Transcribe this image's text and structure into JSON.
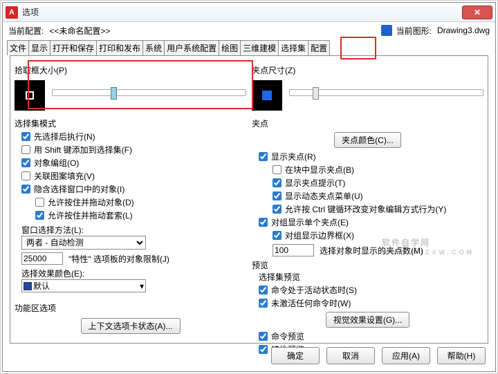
{
  "window": {
    "title": "选项"
  },
  "systembar": {
    "current_profile_label": "当前配置:",
    "current_profile_value": "<<未命名配置>>",
    "current_drawing_label": "当前图形:",
    "current_drawing_value": "Drawing3.dwg"
  },
  "tabs": {
    "t0": "文件",
    "t1": "显示",
    "t2": "打开和保存",
    "t3": "打印和发布",
    "t4": "系统",
    "t5": "用户系统配置",
    "t6": "绘图",
    "t7": "三维建模",
    "t8": "选择集",
    "t9": "配置"
  },
  "left": {
    "pickbox_label": "拾取框大小(P)",
    "selmode_label": "选择集模式",
    "chk_noun_verb": "先选择后执行(N)",
    "chk_shift": "用 Shift 键添加到选择集(F)",
    "chk_obj_group": "对象编组(O)",
    "chk_hatch": "关联图案填充(V)",
    "chk_implied": "隐含选择窗口中的对象(I)",
    "chk_drag_obj": "允许按住并拖动对象(D)",
    "chk_drag_lasso": "允许按住并拖动套索(L)",
    "window_sel_label": "窗口选择方法(L):",
    "window_sel_value": "两者 - 自动检测",
    "limit_value": "25000",
    "limit_label": "\"特性\" 选项板的对象限制(J)",
    "color_label": "选择效果颜色(E):",
    "color_value": "默认",
    "ribbon_label": "功能区选项",
    "btn_ribbon": "上下文选项卡状态(A)..."
  },
  "right": {
    "gripsize_label": "夹点尺寸(Z)",
    "grips_label": "夹点",
    "btn_grip_color": "夹点颜色(C)...",
    "chk_show_grips": "显示夹点(R)",
    "chk_block_grips": "在块中显示夹点(B)",
    "chk_grip_tips": "显示夹点提示(T)",
    "chk_dyn_menu": "显示动态夹点菜单(U)",
    "chk_ctrl_cycle": "允许按 Ctrl 键循环改变对象编辑方式行为(Y)",
    "chk_group_single": "对组显示单个夹点(E)",
    "chk_group_bbox": "对组显示边界框(X)",
    "grip_limit_value": "100",
    "grip_limit_label": "选择对象时显示的夹点数(M)",
    "preview_label": "预览",
    "preview_sub_label": "选择集预览",
    "chk_cmd_active": "命令处于活动状态时(S)",
    "chk_no_cmd": "未激活任何命令时(W)",
    "btn_visual": "视觉效果设置(G)...",
    "chk_cmd_preview": "命令预览",
    "chk_prop_preview": "特性预览"
  },
  "buttons": {
    "ok": "确定",
    "cancel": "取消",
    "apply": "应用(A)",
    "help": "帮助(H)"
  },
  "watermark": {
    "main": "软件自学网",
    "sub": "WWW.RJZXW.COM"
  }
}
